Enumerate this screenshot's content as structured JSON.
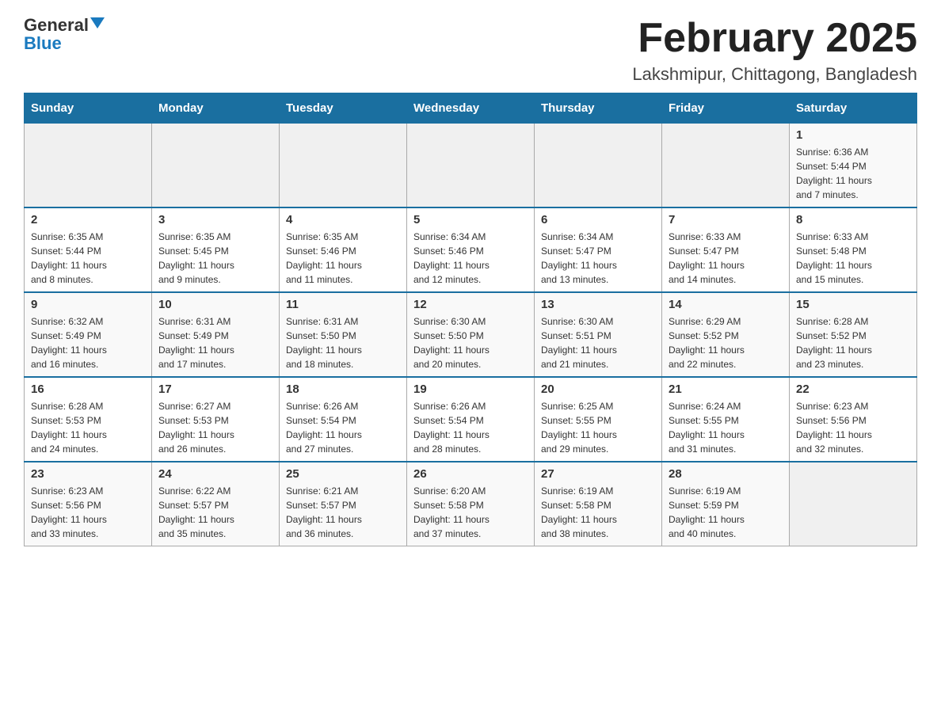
{
  "logo": {
    "general": "General",
    "blue": "Blue"
  },
  "header": {
    "month": "February 2025",
    "location": "Lakshmipur, Chittagong, Bangladesh"
  },
  "weekdays": [
    "Sunday",
    "Monday",
    "Tuesday",
    "Wednesday",
    "Thursday",
    "Friday",
    "Saturday"
  ],
  "weeks": [
    [
      {
        "day": "",
        "info": ""
      },
      {
        "day": "",
        "info": ""
      },
      {
        "day": "",
        "info": ""
      },
      {
        "day": "",
        "info": ""
      },
      {
        "day": "",
        "info": ""
      },
      {
        "day": "",
        "info": ""
      },
      {
        "day": "1",
        "info": "Sunrise: 6:36 AM\nSunset: 5:44 PM\nDaylight: 11 hours\nand 7 minutes."
      }
    ],
    [
      {
        "day": "2",
        "info": "Sunrise: 6:35 AM\nSunset: 5:44 PM\nDaylight: 11 hours\nand 8 minutes."
      },
      {
        "day": "3",
        "info": "Sunrise: 6:35 AM\nSunset: 5:45 PM\nDaylight: 11 hours\nand 9 minutes."
      },
      {
        "day": "4",
        "info": "Sunrise: 6:35 AM\nSunset: 5:46 PM\nDaylight: 11 hours\nand 11 minutes."
      },
      {
        "day": "5",
        "info": "Sunrise: 6:34 AM\nSunset: 5:46 PM\nDaylight: 11 hours\nand 12 minutes."
      },
      {
        "day": "6",
        "info": "Sunrise: 6:34 AM\nSunset: 5:47 PM\nDaylight: 11 hours\nand 13 minutes."
      },
      {
        "day": "7",
        "info": "Sunrise: 6:33 AM\nSunset: 5:47 PM\nDaylight: 11 hours\nand 14 minutes."
      },
      {
        "day": "8",
        "info": "Sunrise: 6:33 AM\nSunset: 5:48 PM\nDaylight: 11 hours\nand 15 minutes."
      }
    ],
    [
      {
        "day": "9",
        "info": "Sunrise: 6:32 AM\nSunset: 5:49 PM\nDaylight: 11 hours\nand 16 minutes."
      },
      {
        "day": "10",
        "info": "Sunrise: 6:31 AM\nSunset: 5:49 PM\nDaylight: 11 hours\nand 17 minutes."
      },
      {
        "day": "11",
        "info": "Sunrise: 6:31 AM\nSunset: 5:50 PM\nDaylight: 11 hours\nand 18 minutes."
      },
      {
        "day": "12",
        "info": "Sunrise: 6:30 AM\nSunset: 5:50 PM\nDaylight: 11 hours\nand 20 minutes."
      },
      {
        "day": "13",
        "info": "Sunrise: 6:30 AM\nSunset: 5:51 PM\nDaylight: 11 hours\nand 21 minutes."
      },
      {
        "day": "14",
        "info": "Sunrise: 6:29 AM\nSunset: 5:52 PM\nDaylight: 11 hours\nand 22 minutes."
      },
      {
        "day": "15",
        "info": "Sunrise: 6:28 AM\nSunset: 5:52 PM\nDaylight: 11 hours\nand 23 minutes."
      }
    ],
    [
      {
        "day": "16",
        "info": "Sunrise: 6:28 AM\nSunset: 5:53 PM\nDaylight: 11 hours\nand 24 minutes."
      },
      {
        "day": "17",
        "info": "Sunrise: 6:27 AM\nSunset: 5:53 PM\nDaylight: 11 hours\nand 26 minutes."
      },
      {
        "day": "18",
        "info": "Sunrise: 6:26 AM\nSunset: 5:54 PM\nDaylight: 11 hours\nand 27 minutes."
      },
      {
        "day": "19",
        "info": "Sunrise: 6:26 AM\nSunset: 5:54 PM\nDaylight: 11 hours\nand 28 minutes."
      },
      {
        "day": "20",
        "info": "Sunrise: 6:25 AM\nSunset: 5:55 PM\nDaylight: 11 hours\nand 29 minutes."
      },
      {
        "day": "21",
        "info": "Sunrise: 6:24 AM\nSunset: 5:55 PM\nDaylight: 11 hours\nand 31 minutes."
      },
      {
        "day": "22",
        "info": "Sunrise: 6:23 AM\nSunset: 5:56 PM\nDaylight: 11 hours\nand 32 minutes."
      }
    ],
    [
      {
        "day": "23",
        "info": "Sunrise: 6:23 AM\nSunset: 5:56 PM\nDaylight: 11 hours\nand 33 minutes."
      },
      {
        "day": "24",
        "info": "Sunrise: 6:22 AM\nSunset: 5:57 PM\nDaylight: 11 hours\nand 35 minutes."
      },
      {
        "day": "25",
        "info": "Sunrise: 6:21 AM\nSunset: 5:57 PM\nDaylight: 11 hours\nand 36 minutes."
      },
      {
        "day": "26",
        "info": "Sunrise: 6:20 AM\nSunset: 5:58 PM\nDaylight: 11 hours\nand 37 minutes."
      },
      {
        "day": "27",
        "info": "Sunrise: 6:19 AM\nSunset: 5:58 PM\nDaylight: 11 hours\nand 38 minutes."
      },
      {
        "day": "28",
        "info": "Sunrise: 6:19 AM\nSunset: 5:59 PM\nDaylight: 11 hours\nand 40 minutes."
      },
      {
        "day": "",
        "info": ""
      }
    ]
  ]
}
